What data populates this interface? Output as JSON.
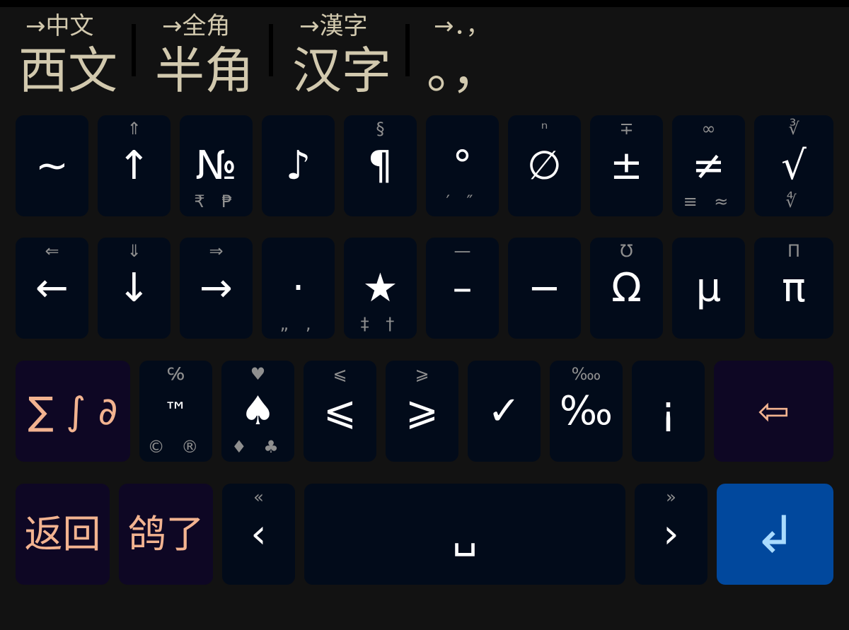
{
  "modes": [
    {
      "hint": "→中文",
      "label": "西文"
    },
    {
      "hint": "→全角",
      "label": "半角"
    },
    {
      "hint": "→漢字",
      "label": "汉字"
    },
    {
      "hint": "→．，",
      "label": "。，"
    }
  ],
  "rows": [
    [
      {
        "main": "~",
        "top": "",
        "bottom": ""
      },
      {
        "main": "↑",
        "top": "⇑",
        "bottom": ""
      },
      {
        "main": "№",
        "top": "",
        "bottom": "₹ ₱"
      },
      {
        "main": "♪",
        "top": "",
        "bottom": ""
      },
      {
        "main": "¶",
        "top": "§",
        "bottom": ""
      },
      {
        "main": "°",
        "top": "",
        "bottom": "′ ″"
      },
      {
        "main": "∅",
        "top": "ⁿ",
        "bottom": ""
      },
      {
        "main": "±",
        "top": "∓",
        "bottom": ""
      },
      {
        "main": "≠",
        "top": "∞",
        "bottom": "≡ ≈"
      },
      {
        "main": "√",
        "top": "∛",
        "bottom": "∜"
      }
    ],
    [
      {
        "main": "←",
        "top": "⇐",
        "bottom": ""
      },
      {
        "main": "↓",
        "top": "⇓",
        "bottom": ""
      },
      {
        "main": "→",
        "top": "⇒",
        "bottom": ""
      },
      {
        "main": "·",
        "top": "",
        "bottom": "„ ‚"
      },
      {
        "main": "★",
        "top": "",
        "bottom": "‡ †"
      },
      {
        "main": "–",
        "top": "—",
        "bottom": ""
      },
      {
        "main": "−",
        "top": "",
        "bottom": ""
      },
      {
        "main": "Ω",
        "top": "℧",
        "bottom": ""
      },
      {
        "main": "µ",
        "top": "",
        "bottom": ""
      },
      {
        "main": "π",
        "top": "Π",
        "bottom": ""
      }
    ],
    [
      {
        "main": "∑ ∫ ∂",
        "top": "",
        "bottom": ""
      },
      {
        "main": "™",
        "top": "℅",
        "bottom": "© ®"
      },
      {
        "main": "♠",
        "top": "♥",
        "bottom": "♦ ♣"
      },
      {
        "main": "⩽",
        "top": "⩽",
        "bottom": ""
      },
      {
        "main": "⩾",
        "top": "⩾",
        "bottom": ""
      },
      {
        "main": "✓",
        "top": "",
        "bottom": ""
      },
      {
        "main": "‰",
        "top": "‱",
        "bottom": ""
      },
      {
        "main": "¡",
        "top": "",
        "bottom": ""
      },
      {
        "main": "⇦",
        "top": "",
        "bottom": ""
      }
    ],
    [
      {
        "main": "返回",
        "top": "",
        "bottom": ""
      },
      {
        "main": "鸽了",
        "top": "",
        "bottom": ""
      },
      {
        "main": "‹",
        "top": "«",
        "bottom": ""
      },
      {
        "main": "␣",
        "top": "",
        "bottom": ""
      },
      {
        "main": "›",
        "top": "»",
        "bottom": ""
      },
      {
        "main": "↲",
        "top": "",
        "bottom": ""
      }
    ]
  ],
  "colors": {
    "background": "#121212",
    "key": "#020b1a",
    "function_key": "#0e0724",
    "enter_key": "#01489d",
    "hint_text": "#d2c9ae",
    "function_text": "#f2b390"
  }
}
